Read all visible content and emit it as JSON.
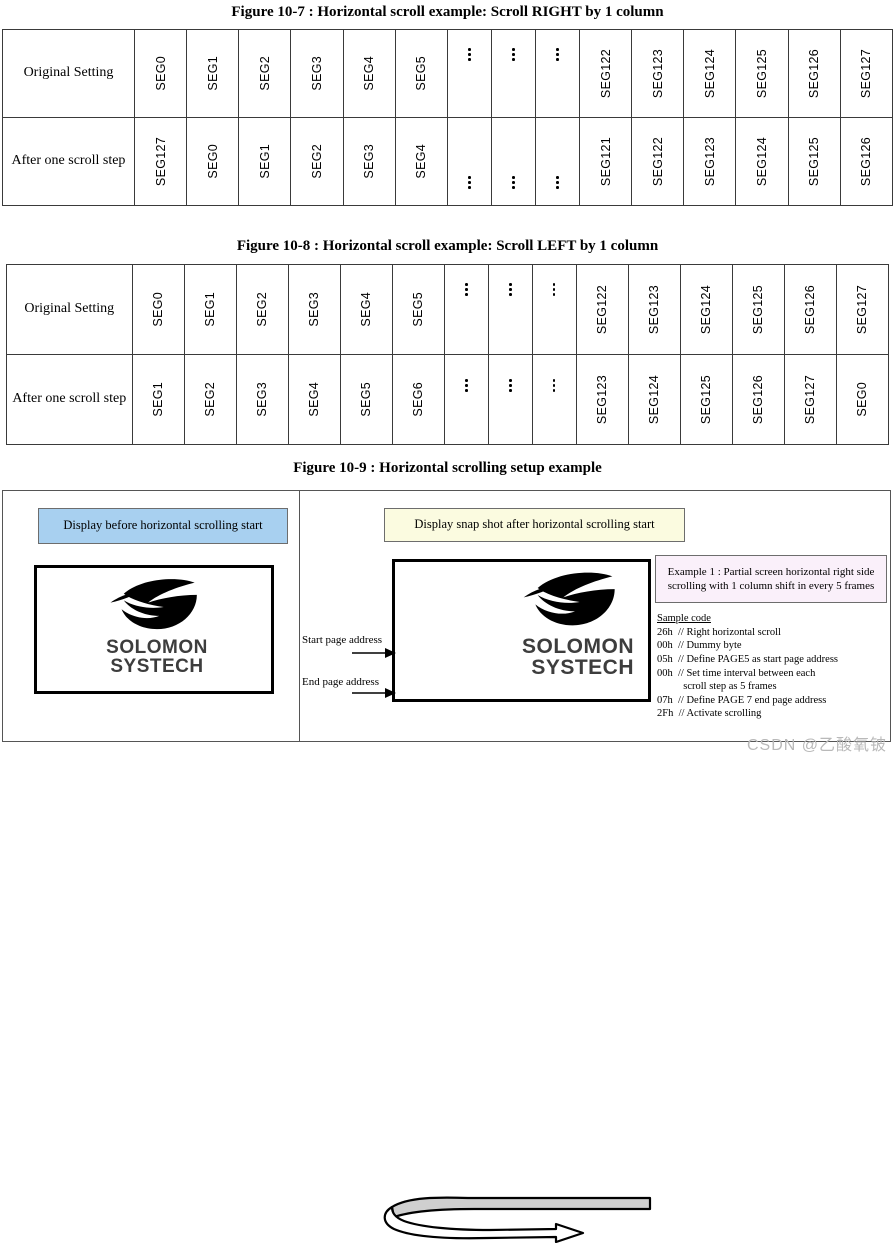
{
  "figures": {
    "fig107_title": "Figure 10-7 : Horizontal scroll example: Scroll RIGHT by 1 column",
    "fig108_title": "Figure 10-8 : Horizontal scroll example: Scroll LEFT by 1 column",
    "fig109_title": "Figure 10-9 : Horizontal scrolling setup example"
  },
  "table_107": {
    "rows": [
      {
        "label": "Original Setting",
        "cells": [
          "SEG0",
          "SEG1",
          "SEG2",
          "SEG3",
          "SEG4",
          "SEG5",
          "⋮",
          "⋮",
          "⋮",
          "SEG122",
          "SEG123",
          "SEG124",
          "SEG125",
          "SEG126",
          "SEG127"
        ]
      },
      {
        "label": "After one scroll step",
        "cells": [
          "SEG127",
          "SEG0",
          "SEG1",
          "SEG2",
          "SEG3",
          "SEG4",
          "⋮",
          "⋮",
          "⋮",
          "SEG121",
          "SEG122",
          "SEG123",
          "SEG124",
          "SEG125",
          "SEG126"
        ]
      }
    ]
  },
  "table_108": {
    "rows": [
      {
        "label": "Original Setting",
        "cells": [
          "SEG0",
          "SEG1",
          "SEG2",
          "SEG3",
          "SEG4",
          "SEG5",
          "⋮",
          "⋮",
          "⋮",
          "SEG122",
          "SEG123",
          "SEG124",
          "SEG125",
          "SEG126",
          "SEG127"
        ]
      },
      {
        "label": "After one scroll step",
        "cells": [
          "SEG1",
          "SEG2",
          "SEG3",
          "SEG4",
          "SEG5",
          "SEG6",
          "⋮",
          "⋮",
          "⋮",
          "SEG123",
          "SEG124",
          "SEG125",
          "SEG126",
          "SEG127",
          "SEG0"
        ]
      }
    ]
  },
  "diagram": {
    "callout_before": "Display before horizontal scrolling start",
    "callout_after": "Display snap shot after horizontal scrolling start",
    "callout_example": "Example 1 : Partial screen horizontal right side scrolling with 1 column shift in every 5 frames",
    "label_start_page": "Start page address",
    "label_end_page": "End page address",
    "logo_line1": "SOLOMON",
    "logo_line2": "SYSTECH",
    "sample_code_header": "Sample code",
    "sample_code_lines": [
      "26h  // Right horizontal scroll",
      "00h  // Dummy byte",
      "05h  // Define PAGE5 as start page address",
      "00h  // Set time interval between each",
      "          scroll step as 5 frames",
      "07h  // Define PAGE 7 end page address",
      "2Fh  // Activate scrolling"
    ]
  },
  "colors": {
    "callout_before_bg": "#a8d0f0",
    "callout_after_bg": "#fbfbe0",
    "callout_example_bg": "#faf0fa",
    "table_border": "#3a3a3a",
    "watermark": "#b9b9b9"
  },
  "watermark": "CSDN @乙酸氧铍"
}
